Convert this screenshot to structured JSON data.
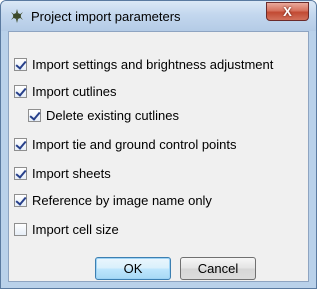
{
  "window": {
    "title": "Project import parameters",
    "close_label": "X"
  },
  "options": [
    {
      "label": "Import settings and brightness adjustment",
      "checked": true
    },
    {
      "label": "Import cutlines",
      "checked": true
    },
    {
      "label": "Delete existing cutlines",
      "checked": true
    },
    {
      "label": "Import tie and ground control points",
      "checked": true
    },
    {
      "label": "Import sheets",
      "checked": true
    },
    {
      "label": "Reference by image name only",
      "checked": true
    },
    {
      "label": "Import cell size",
      "checked": false
    }
  ],
  "buttons": {
    "ok_label": "OK",
    "cancel_label": "Cancel"
  }
}
